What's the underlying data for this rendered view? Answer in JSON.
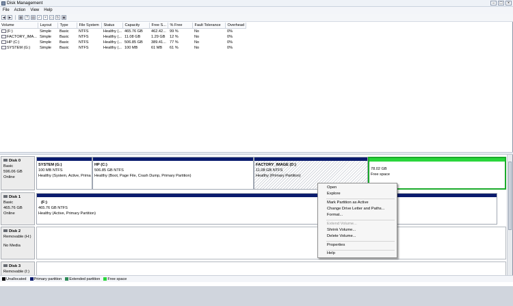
{
  "window": {
    "title": "Disk Management"
  },
  "menu": [
    "File",
    "Action",
    "View",
    "Help"
  ],
  "volume_table": {
    "columns": [
      "Volume",
      "Layout",
      "Type",
      "File System",
      "Status",
      "Capacity",
      "Free S...",
      "% Free",
      "Fault Tolerance",
      "Overhead"
    ],
    "rows": [
      [
        "(F:)",
        "Simple",
        "Basic",
        "NTFS",
        "Healthy (...",
        "465.76 GB",
        "462.42...",
        "99 %",
        "No",
        "0%"
      ],
      [
        "FACTORY_IMA...",
        "Simple",
        "Basic",
        "NTFS",
        "Healthy (...",
        "11.08 GB",
        "1.29 GB",
        "12 %",
        "No",
        "0%"
      ],
      [
        "HP (C:)",
        "Simple",
        "Basic",
        "NTFS",
        "Healthy (...",
        "506.85 GB",
        "389.41...",
        "77 %",
        "No",
        "0%"
      ],
      [
        "SYSTEM (G:)",
        "Simple",
        "Basic",
        "NTFS",
        "Healthy (...",
        "100 MB",
        "61 MB",
        "61 %",
        "No",
        "0%"
      ]
    ]
  },
  "disks": [
    {
      "name": "Disk 0",
      "kind": "Basic",
      "size": "596.06 GB",
      "state": "Online",
      "partitions": [
        {
          "name": "SYSTEM  (G:)",
          "size": "100 MB NTFS",
          "status": "Healthy (System, Active, Prima"
        },
        {
          "name": "HP  (C:)",
          "size": "506.85 GB NTFS",
          "status": "Healthy (Boot, Page File, Crash Dump, Primary Partition)"
        },
        {
          "name": "FACTORY_IMAGE  (D:)",
          "size": "11.08 GB NTFS",
          "status": "Healthy (Primary Partition)"
        },
        {
          "name": "",
          "size": "78.02 GB",
          "status": "Free space"
        }
      ]
    },
    {
      "name": "Disk 1",
      "kind": "Basic",
      "size": "465.76 GB",
      "state": "Online",
      "partitions": [
        {
          "name": "(F:)",
          "size": "465.76 GB NTFS",
          "status": "Healthy (Active, Primary Partition)"
        }
      ]
    },
    {
      "name": "Disk 2",
      "kind": "Removable (H:)",
      "state": "No Media"
    },
    {
      "name": "Disk 3",
      "kind": "Removable (I:)"
    }
  ],
  "context_menu": {
    "items": [
      {
        "label": "Open",
        "enabled": true
      },
      {
        "label": "Explore",
        "enabled": true
      },
      {
        "label": "Mark Partition as Active",
        "enabled": true
      },
      {
        "label": "Change Drive Letter and Paths...",
        "enabled": true
      },
      {
        "label": "Format...",
        "enabled": true
      },
      {
        "label": "Extend Volume...",
        "enabled": false
      },
      {
        "label": "Shrink Volume...",
        "enabled": true
      },
      {
        "label": "Delete Volume...",
        "enabled": true
      },
      {
        "label": "Properties",
        "enabled": true
      },
      {
        "label": "Help",
        "enabled": true
      }
    ]
  },
  "legend": [
    {
      "label": "Unallocated",
      "color": "#000000"
    },
    {
      "label": "Primary partition",
      "color": "#0b1c6e"
    },
    {
      "label": "Extended partition",
      "color": "#2e8b57"
    },
    {
      "label": "Free space",
      "color": "#29d63c"
    }
  ],
  "colors": {
    "primary_bar": "#0b1c6e",
    "free_space": "#29d63c"
  }
}
